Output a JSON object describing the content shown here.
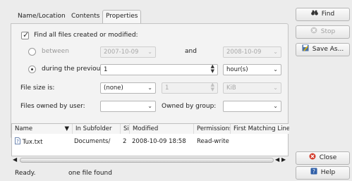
{
  "tabs": [
    {
      "label": "Name/Location",
      "active": false
    },
    {
      "label": "Contents",
      "active": false
    },
    {
      "label": "Properties",
      "active": true
    }
  ],
  "properties": {
    "find_modified_label": "Find all files created or modified:",
    "find_modified_checked": true,
    "between_label": "between",
    "between_from": "2007-10-09",
    "and_label": "and",
    "between_to": "2008-10-09",
    "previous_label": "during the previous",
    "previous_value": "1",
    "previous_unit": "hour(s)",
    "size_label": "File size is:",
    "size_mode": "(none)",
    "size_value": "1",
    "size_unit": "KiB",
    "owned_user_label": "Files owned by user:",
    "owned_user_value": "",
    "owned_group_label": "Owned by group:",
    "owned_group_value": ""
  },
  "buttons": {
    "find": "Find",
    "stop": "Stop",
    "save_as": "Save As...",
    "close": "Close",
    "help": "Help"
  },
  "results": {
    "columns": [
      "Name",
      "In Subfolder",
      "Size",
      "Modified",
      "Permissions",
      "First Matching Line"
    ],
    "rows": [
      {
        "name": "Tux.txt",
        "folder": "Documents/",
        "size": "2",
        "modified": "2008-10-09 18:58",
        "permissions": "Read-write",
        "first_line": ""
      }
    ]
  },
  "status": {
    "state": "Ready.",
    "count": "one file found"
  },
  "icons": {
    "find": "binoculars-icon",
    "stop": "stop-icon",
    "save": "save-icon",
    "close": "close-icon",
    "help": "help-icon",
    "file": "text-file-icon"
  }
}
